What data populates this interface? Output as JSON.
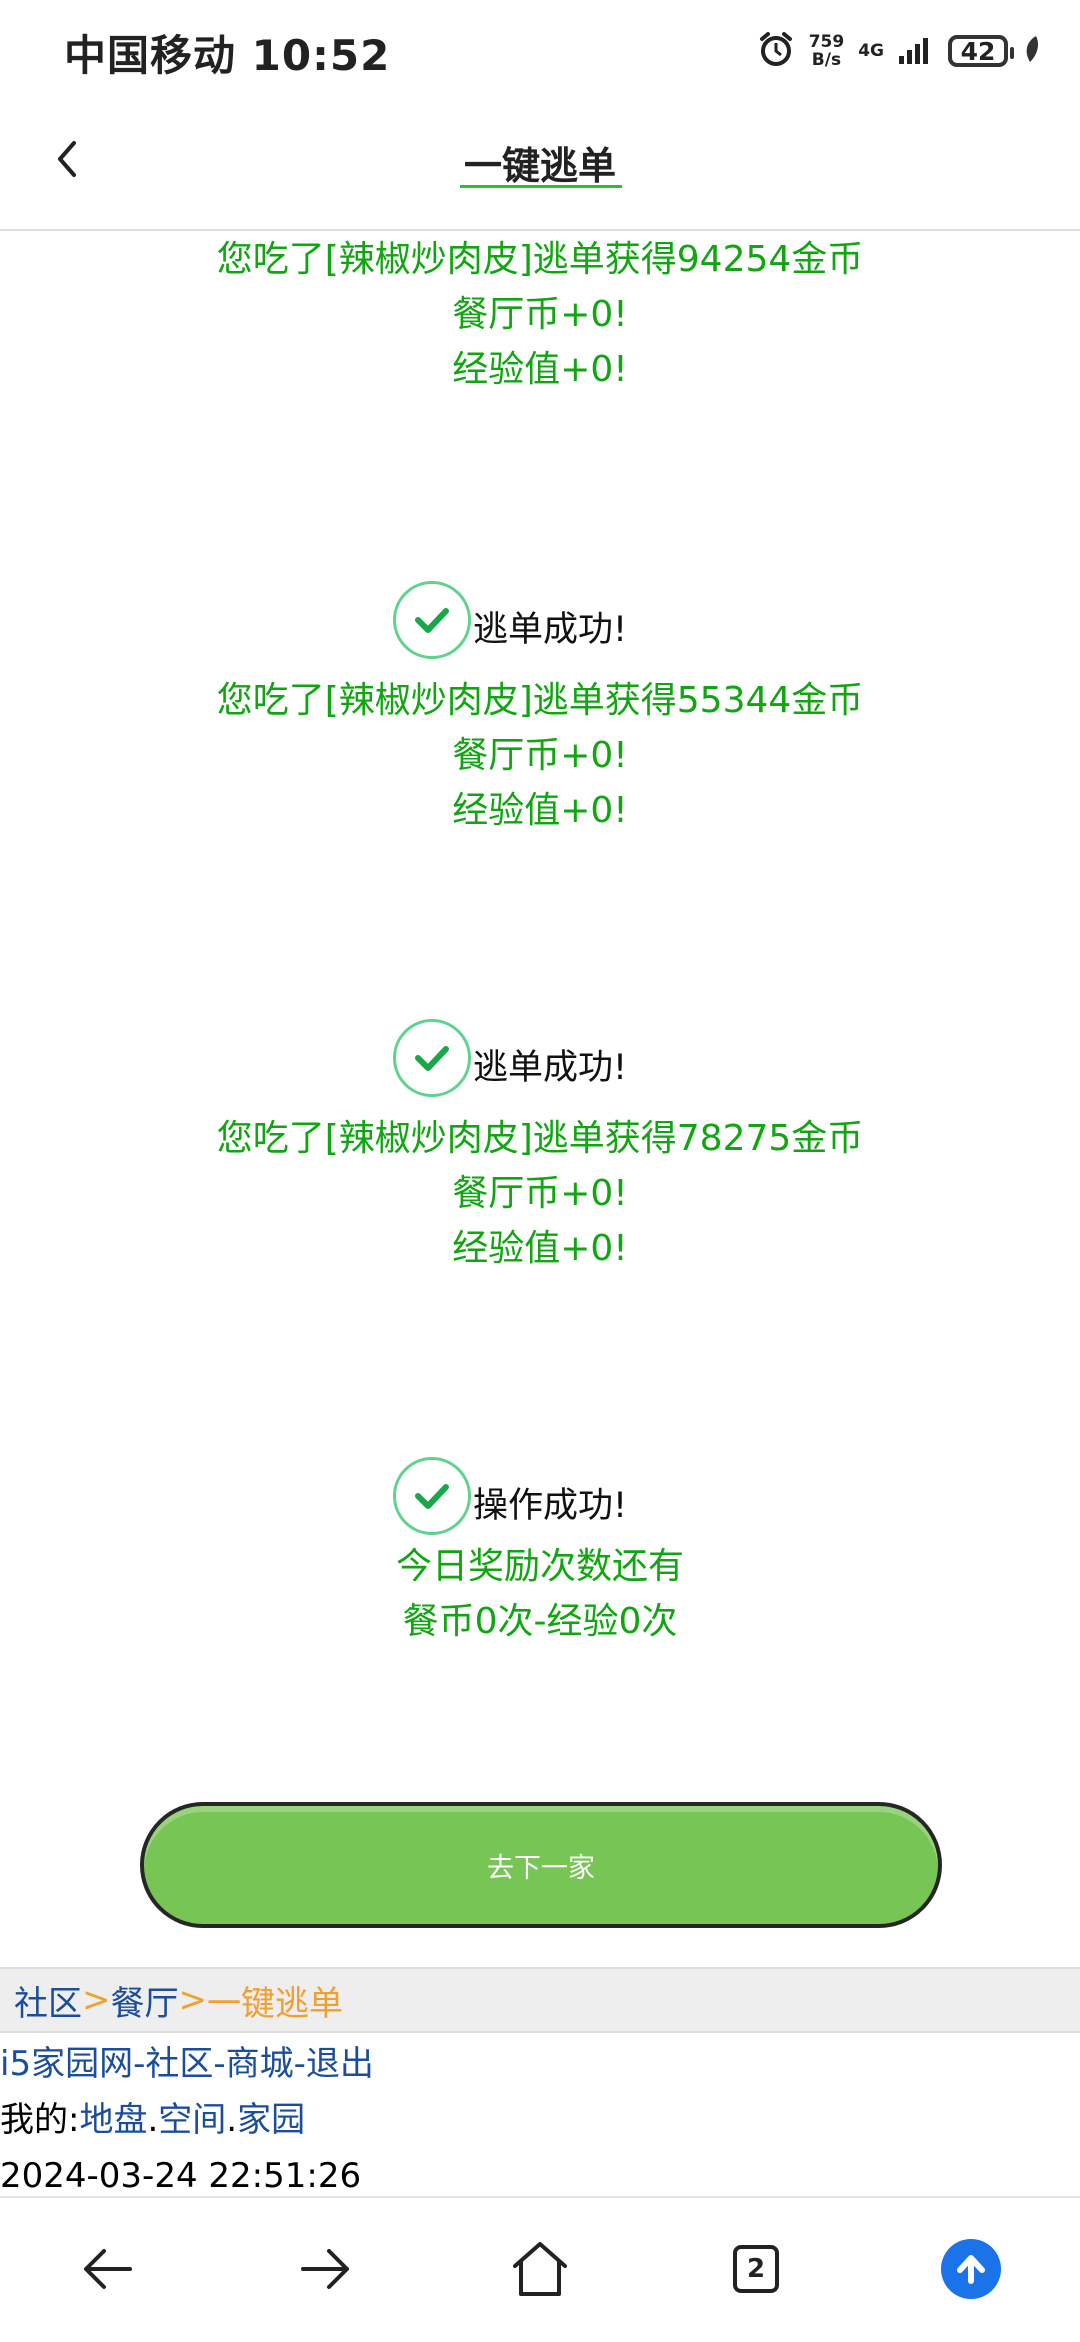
{
  "status_bar": {
    "carrier": "中国移动",
    "time": "10:52",
    "net_speed_value": "759",
    "net_speed_unit": "B/s",
    "network": "4G",
    "battery": "42"
  },
  "header": {
    "title": "一键逃单"
  },
  "results": [
    {
      "message": "您吃了[辣椒炒肉皮]逃单获得94254金币",
      "restaurant_coin": "餐厅币+0!",
      "exp": "经验值+0!"
    },
    {
      "status": "逃单成功!",
      "message": "您吃了[辣椒炒肉皮]逃单获得55344金币",
      "restaurant_coin": "餐厅币+0!",
      "exp": "经验值+0!"
    },
    {
      "status": "逃单成功!",
      "message": "您吃了[辣椒炒肉皮]逃单获得78275金币",
      "restaurant_coin": "餐厅币+0!",
      "exp": "经验值+0!"
    }
  ],
  "final": {
    "status": "操作成功!",
    "line1": "今日奖励次数还有",
    "line2": "餐币0次-经验0次"
  },
  "next_button": "去下一家",
  "breadcrumb": {
    "community": "社区",
    "sep": ">",
    "restaurant": "餐厅",
    "current": "一键逃单"
  },
  "footer": {
    "site": "i5家园网",
    "dash": "-",
    "community": "社区",
    "mall": "商城",
    "logout": "退出",
    "mine_label": "我的:",
    "land": "地盘",
    "dot": ".",
    "space": "空间",
    "home": "家园",
    "datetime": "2024-03-24 22:51:26"
  },
  "bottom_nav": {
    "tab_count": "2"
  },
  "colors": {
    "green_text": "#11a611",
    "button_green": "#77c555",
    "link_blue": "#1a4e9a",
    "accent_orange": "#f0a030"
  }
}
